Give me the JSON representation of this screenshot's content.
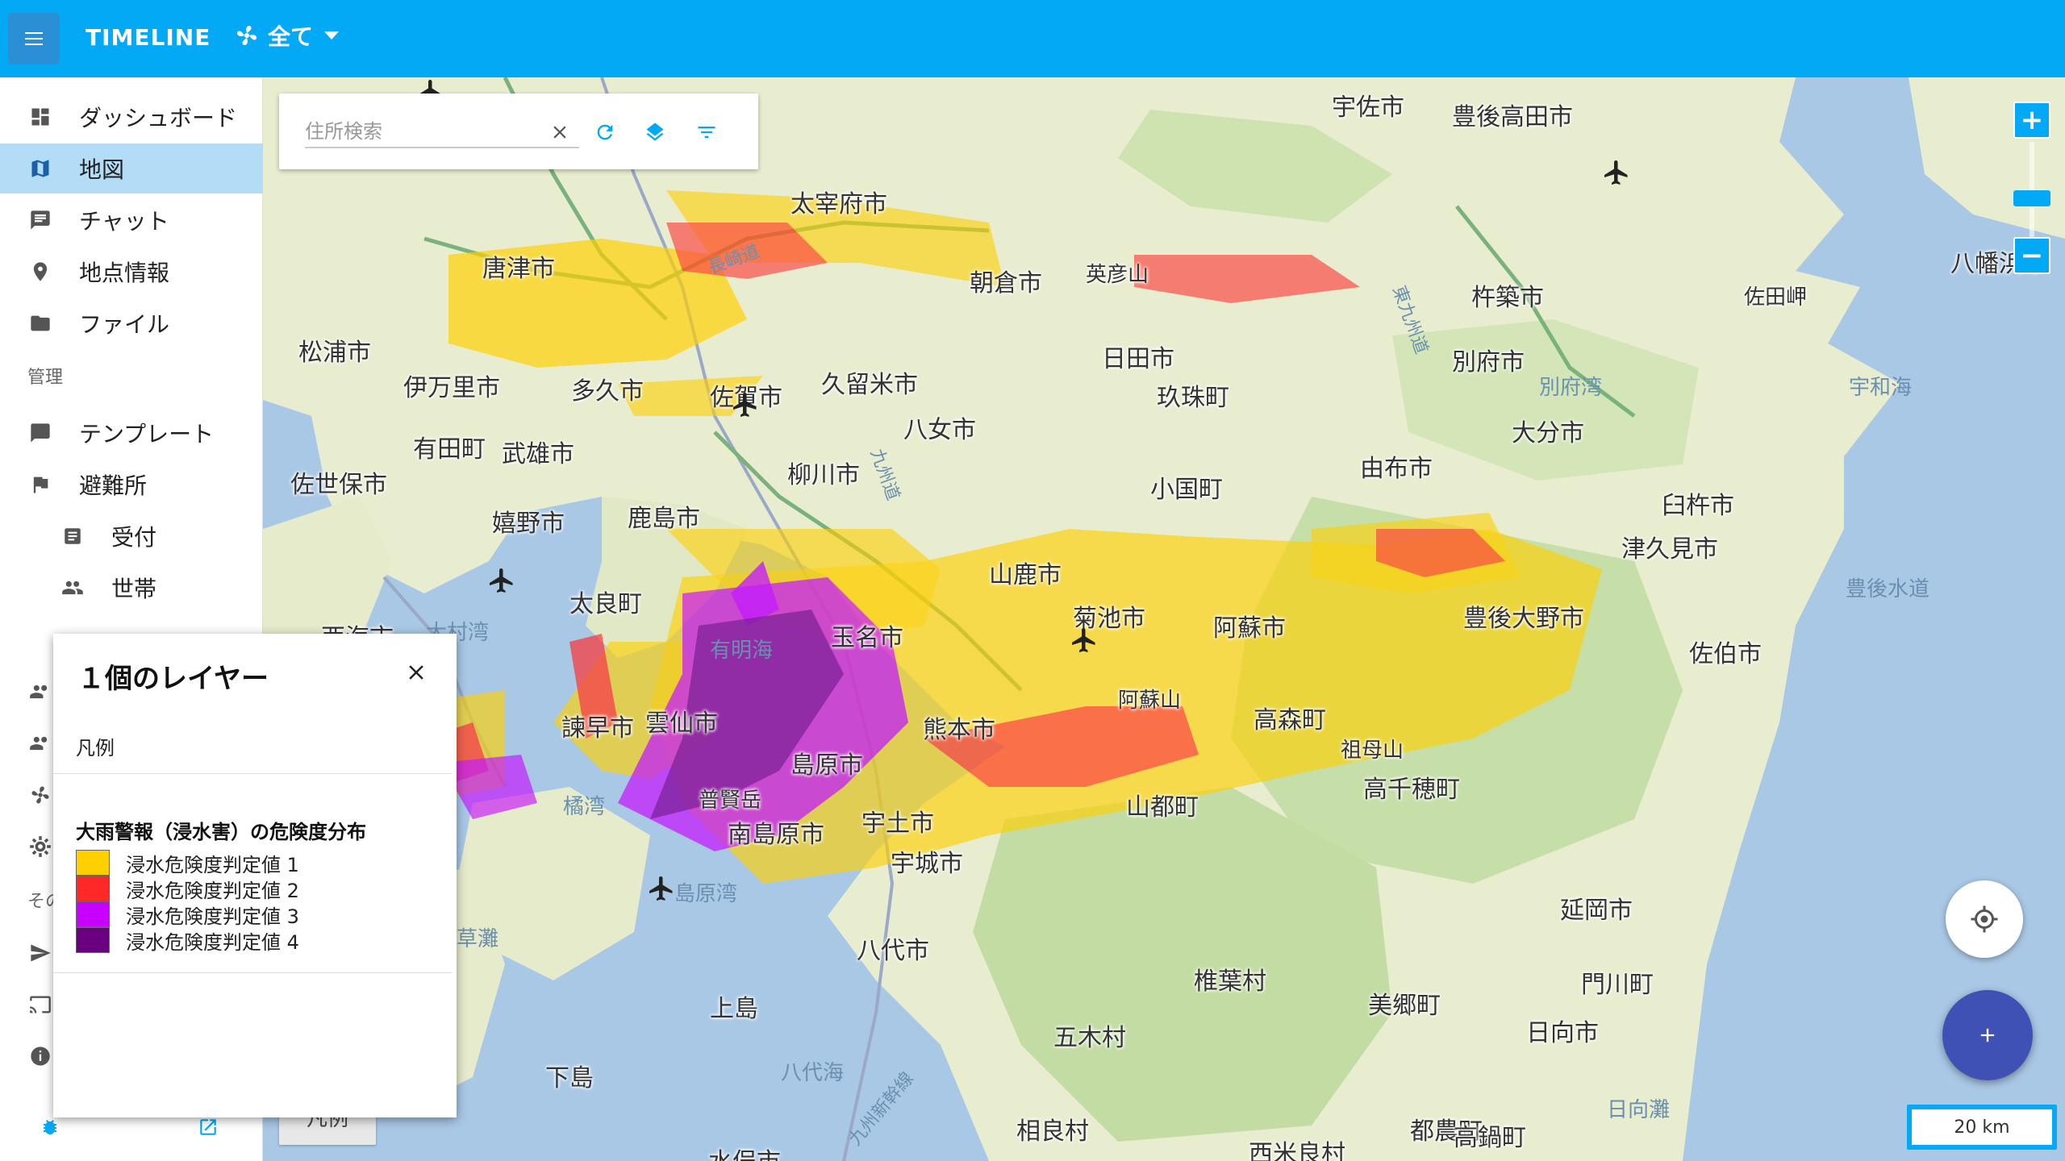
{
  "header": {
    "title": "TIMELINE",
    "filter_label": "全て"
  },
  "sidebar": {
    "items": [
      {
        "label": "ダッシュボード"
      },
      {
        "label": "地図"
      },
      {
        "label": "チャット"
      },
      {
        "label": "地点情報"
      },
      {
        "label": "ファイル"
      }
    ],
    "section_admin": "管理",
    "admin_items": [
      {
        "label": "テンプレート"
      },
      {
        "label": "避難所"
      },
      {
        "label": "受付"
      },
      {
        "label": "世帯"
      }
    ],
    "section_other": "その"
  },
  "search": {
    "placeholder": "住所検索",
    "value": ""
  },
  "layer_panel": {
    "title": "１個のレイヤー",
    "legend_header": "凡例",
    "legend_title": "大雨警報（浸水害）の危険度分布",
    "entries": [
      {
        "label": "浸水危険度判定値 1",
        "color": "#ffd000"
      },
      {
        "label": "浸水危険度判定値 2",
        "color": "#ff2828"
      },
      {
        "label": "浸水危険度判定値 3",
        "color": "#c800ff"
      },
      {
        "label": "浸水危険度判定値 4",
        "color": "#6a0080"
      }
    ]
  },
  "legend_button": {
    "label": "凡例"
  },
  "scale": {
    "label": "20 km"
  },
  "map": {
    "places": [
      {
        "label": "太宰府市"
      },
      {
        "label": "宇佐市"
      },
      {
        "label": "豊後高田市"
      },
      {
        "label": "唐津市"
      },
      {
        "label": "朝倉市"
      },
      {
        "label": "英彦山"
      },
      {
        "label": "杵築市"
      },
      {
        "label": "佐田岬"
      },
      {
        "label": "八幡浜市"
      },
      {
        "label": "松浦市"
      },
      {
        "label": "伊万里市"
      },
      {
        "label": "多久市"
      },
      {
        "label": "佐賀市"
      },
      {
        "label": "久留米市"
      },
      {
        "label": "日田市"
      },
      {
        "label": "別府市"
      },
      {
        "label": "別府湾"
      },
      {
        "label": "宇和海"
      },
      {
        "label": "玖珠町"
      },
      {
        "label": "有田町"
      },
      {
        "label": "武雄市"
      },
      {
        "label": "八女市"
      },
      {
        "label": "大分市"
      },
      {
        "label": "佐世保市"
      },
      {
        "label": "柳川市"
      },
      {
        "label": "由布市"
      },
      {
        "label": "嬉野市"
      },
      {
        "label": "鹿島市"
      },
      {
        "label": "小国町"
      },
      {
        "label": "臼杵市"
      },
      {
        "label": "津久見市"
      },
      {
        "label": "山鹿市"
      },
      {
        "label": "豊後水道"
      },
      {
        "label": "太良町"
      },
      {
        "label": "菊池市"
      },
      {
        "label": "西海市"
      },
      {
        "label": "大村湾"
      },
      {
        "label": "有明海"
      },
      {
        "label": "玉名市"
      },
      {
        "label": "阿蘇市"
      },
      {
        "label": "豊後大野市"
      },
      {
        "label": "佐伯市"
      },
      {
        "label": "阿蘇山"
      },
      {
        "label": "熊本市"
      },
      {
        "label": "高森町"
      },
      {
        "label": "諫早市"
      },
      {
        "label": "雲仙市"
      },
      {
        "label": "島原市"
      },
      {
        "label": "祖母山"
      },
      {
        "label": "橘湾"
      },
      {
        "label": "普賢岳"
      },
      {
        "label": "山都町"
      },
      {
        "label": "高千穂町"
      },
      {
        "label": "宇土市"
      },
      {
        "label": "南島原市"
      },
      {
        "label": "宇城市"
      },
      {
        "label": "島原湾"
      },
      {
        "label": "延岡市"
      },
      {
        "label": "八代市"
      },
      {
        "label": "椎葉村"
      },
      {
        "label": "門川町"
      },
      {
        "label": "上島"
      },
      {
        "label": "美郷町"
      },
      {
        "label": "五木村"
      },
      {
        "label": "日向市"
      },
      {
        "label": "下島"
      },
      {
        "label": "八代海"
      },
      {
        "label": "日向灘"
      },
      {
        "label": "相良村"
      },
      {
        "label": "都農町"
      },
      {
        "label": "西米良村"
      },
      {
        "label": "水俣市"
      },
      {
        "label": "高鍋町"
      },
      {
        "label": "九州新幹線"
      },
      {
        "label": "長崎道"
      },
      {
        "label": "九州道"
      },
      {
        "label": "東九州道"
      },
      {
        "label": "草灘"
      }
    ]
  }
}
